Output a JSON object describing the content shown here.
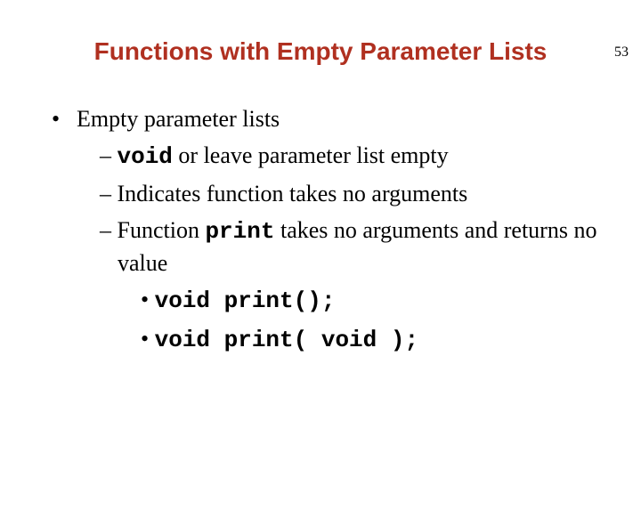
{
  "page_number": "53",
  "title": "Functions with Empty Parameter Lists",
  "bullets": {
    "l1": "Empty parameter lists",
    "l2a_code": "void",
    "l2a_rest": " or leave parameter list empty",
    "l2b": "Indicates function takes no arguments",
    "l2c_pre": "Function ",
    "l2c_code": "print",
    "l2c_post": " takes no arguments and returns no value",
    "l3a": "void print();",
    "l3b": "void print( void );"
  }
}
